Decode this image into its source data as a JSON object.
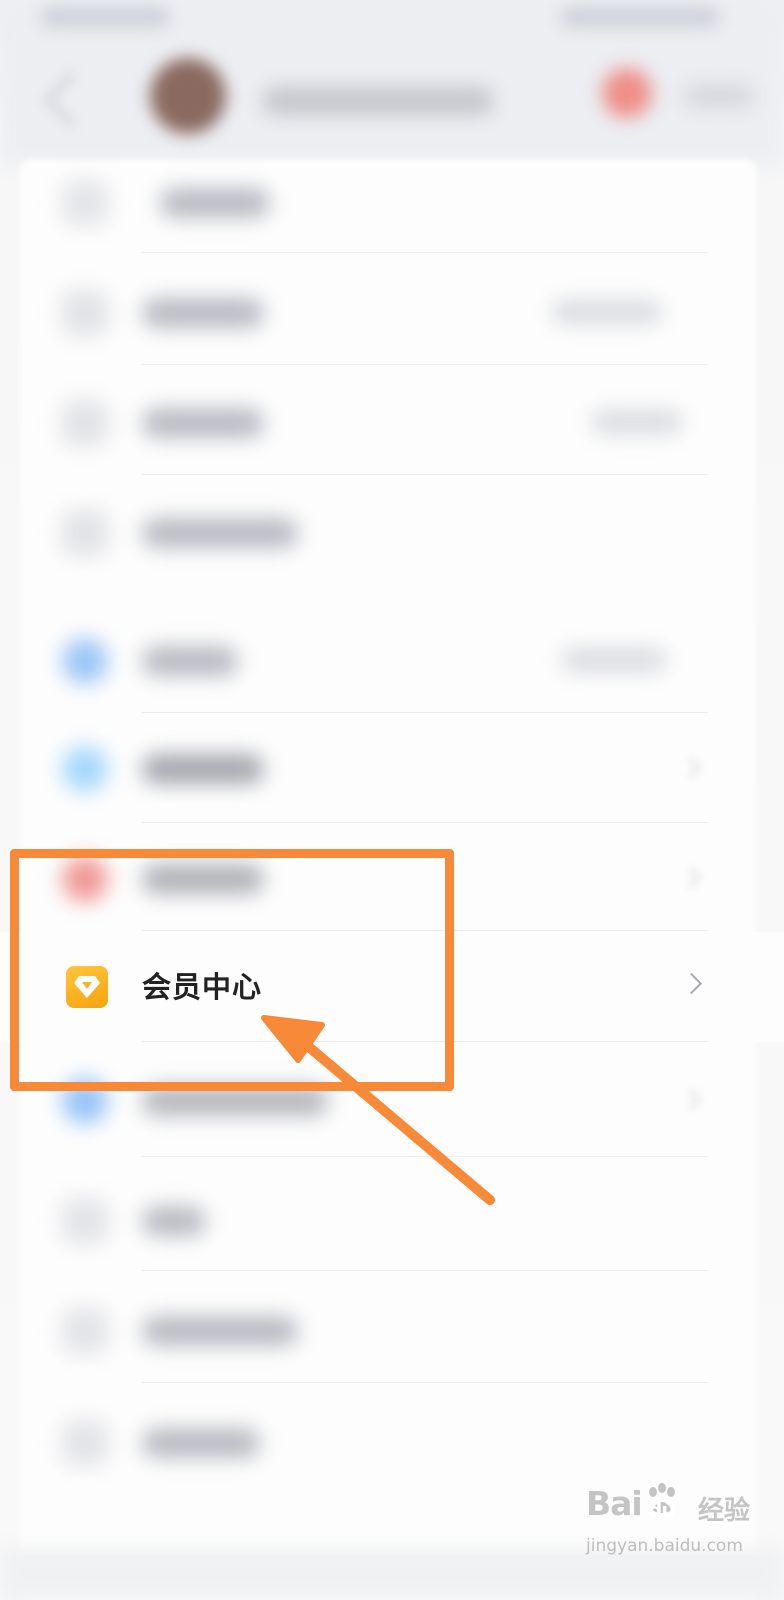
{
  "member_row": {
    "label": "会员中心",
    "icon": "diamond-icon",
    "icon_color": "#fbb52a"
  },
  "annotation": {
    "box_color": "#f68a38",
    "arrow_color": "#f68a38"
  },
  "watermark": {
    "logo_left": "Bai",
    "logo_right": "du",
    "product": "经验",
    "url": "jingyan.baidu.com"
  },
  "colors": {
    "background": "#f8f8f9",
    "blurred_icon_blue": "#9cc6f5",
    "blurred_icon_red": "#ef9a98"
  }
}
